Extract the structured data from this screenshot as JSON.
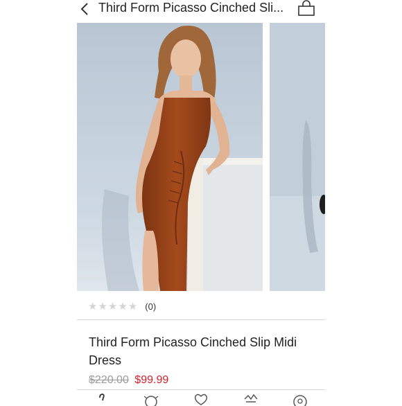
{
  "header": {
    "title": "Third Form Picasso Cinched Sli..."
  },
  "product": {
    "rating_count": "(0)",
    "name": "Third Form Picasso Cinched Slip Midi Dress",
    "original_price": "$220.00",
    "sale_price": "$99.99"
  },
  "icons": {
    "back": "chevron-left-icon",
    "bag": "shopping-bag-icon",
    "tabs": [
      "closet-tab-icon",
      "explore-tab-icon",
      "likes-tab-icon",
      "news-tab-icon",
      "account-tab-icon"
    ]
  },
  "colors": {
    "sale": "#d3212c",
    "dress": "#9c4419",
    "backdrop": "#c6d3df"
  }
}
